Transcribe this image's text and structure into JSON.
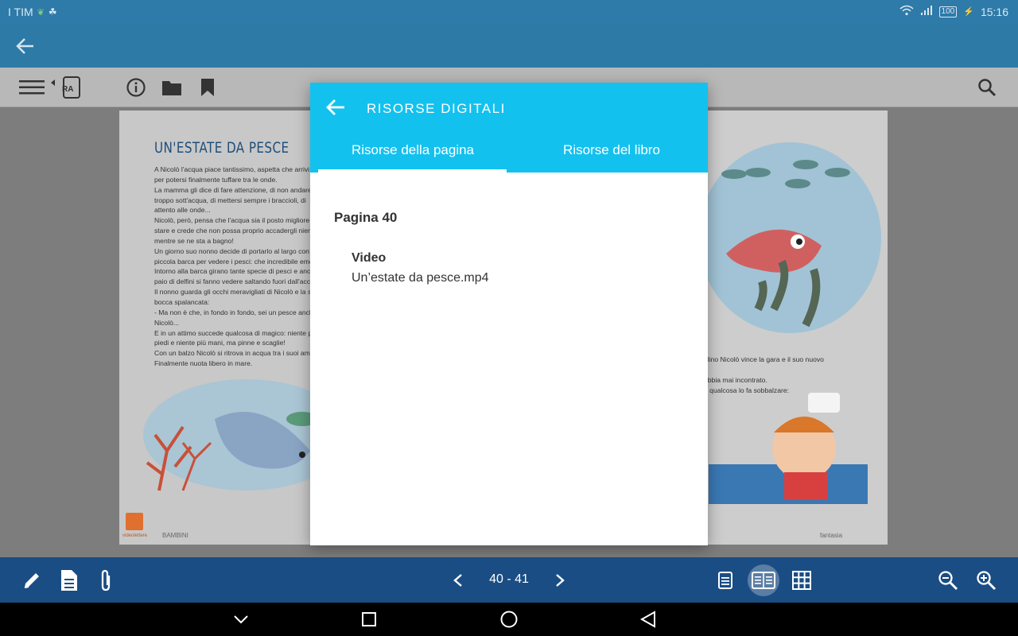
{
  "status_bar": {
    "carrier": "I TIM",
    "battery": "100",
    "time": "15:16"
  },
  "toolbar": {
    "ra_label": "RA"
  },
  "book": {
    "left_page": {
      "title": "UN'ESTATE DA PESCE",
      "lines": [
        "A Nicolò l'acqua piace tantissimo, aspetta che arrivi i",
        "per potersi finalmente tuffare tra le onde.",
        "La mamma gli dice di fare attenzione, di non andare",
        "troppo sott'acqua, di mettersi sempre i braccioli, di",
        "attento alle onde...",
        "Nicolò, però, pensa che l'acqua sia il posto migliore",
        "stare e crede che non possa proprio accadergli nien",
        "mentre se ne sta a bagno!",
        "Un giorno suo nonno decide di portarlo al largo con",
        "piccola barca per vedere i pesci: che incredibile emo",
        "Intorno alla barca girano tante specie di pesci e anc",
        "paio di delfini si fanno vedere saltando fuori dall'acc",
        "Il nonno guarda gli occhi meravigliati di Nicolò e la s",
        "bocca spalancata:",
        "- Ma non è che, in fondo in fondo, sei un pesce anch",
        "Nicolò...",
        "E in un attimo succede qualcosa di magico: niente p",
        "piedi e niente più mani, ma pinne e scaglie!",
        "Con un balzo Nicolò si ritrova in acqua tra i suoi ami",
        "Finalmente nuota libero in mare."
      ],
      "footer": "BAMBINI",
      "logo_text": "videolettere"
    },
    "right_page": {
      "lines": [
        "olino Nicolò vince la gara e il suo nuovo",
        "",
        "abbia mai incontrato.",
        "è qualcosa lo fa sobbalzare:"
      ],
      "footer": "fantasia"
    }
  },
  "dialog": {
    "title": "RISORSE DIGITALI",
    "tabs": [
      {
        "label": "Risorse della pagina",
        "active": true
      },
      {
        "label": "Risorse del libro",
        "active": false
      }
    ],
    "section_title": "Pagina 40",
    "resource": {
      "type": "Video",
      "name": "Un’estate da pesce.mp4"
    }
  },
  "bottom_bar": {
    "page_indicator": "40 - 41"
  },
  "colors": {
    "status_bar": "#2e7aa8",
    "app_bar": "#2d7aa7",
    "dialog_header": "#13c1ef",
    "bottom_bar": "#1a4d84"
  }
}
